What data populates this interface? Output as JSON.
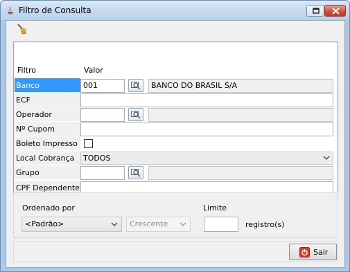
{
  "window": {
    "title": "Filtro de Consulta"
  },
  "toolbar": {
    "clear_icon": "broom-icon"
  },
  "grid": {
    "header": {
      "filter": "Filtro",
      "value": "Valor"
    },
    "rows": [
      {
        "label": "Banco",
        "code": "",
        "description": "BANCO DO BRASIL S/A"
      },
      {
        "label": "ECF",
        "value": ""
      },
      {
        "label": "Operador",
        "code": "",
        "description": ""
      },
      {
        "label": "Nº Cupom",
        "value": ""
      },
      {
        "label": "Boleto Impresso",
        "checked": false
      },
      {
        "label": "Local Cobrança",
        "value": "TODOS"
      },
      {
        "label": "Grupo",
        "code": "",
        "description": ""
      },
      {
        "label": "CPF Dependente",
        "value": ""
      }
    ],
    "banco_code": "001"
  },
  "order": {
    "ordered_by_label": "Ordenado por",
    "ordered_by_value": "<Padrão>",
    "direction_value": "Crescente",
    "limit_label": "Limite",
    "limit_value": "",
    "records_label": "registro(s)"
  },
  "footer": {
    "exit_label": "Sair"
  }
}
